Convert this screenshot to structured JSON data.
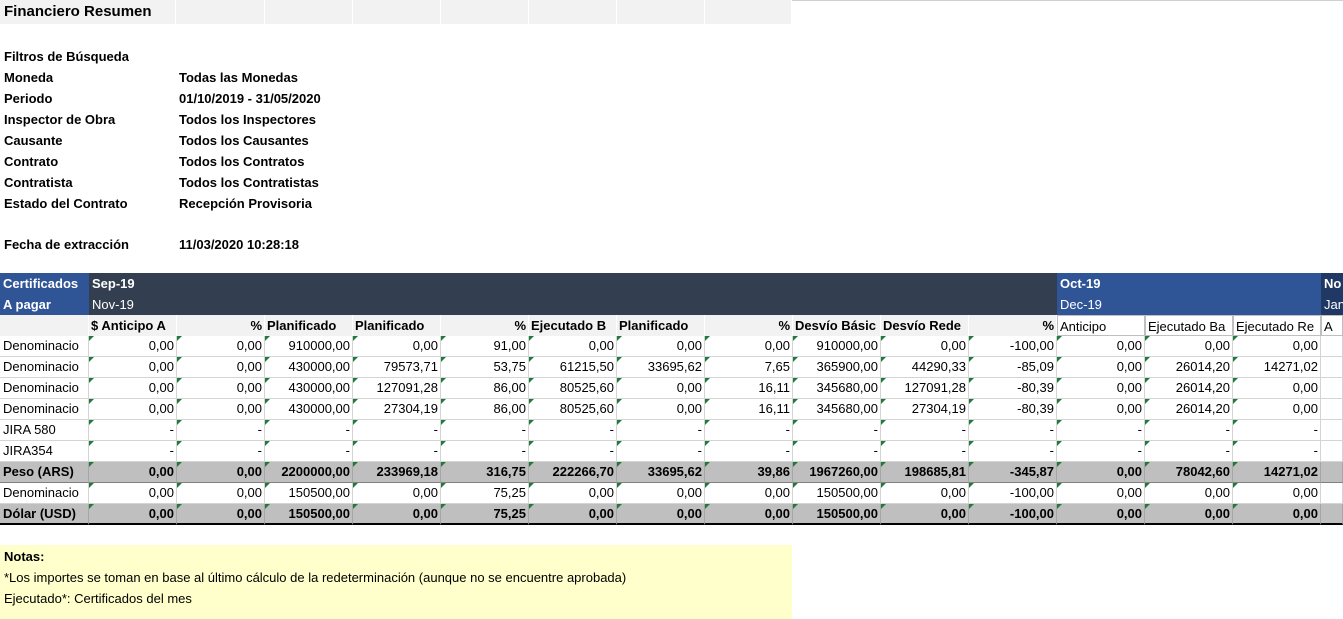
{
  "sheet": {
    "title": "Financiero Resumen"
  },
  "filters": {
    "section_label": "Filtros de Búsqueda",
    "items": [
      {
        "label": "Moneda",
        "value": "Todas las Monedas"
      },
      {
        "label": "Periodo",
        "value": "01/10/2019 - 31/05/2020"
      },
      {
        "label": "Inspector de Obra",
        "value": "Todos los Inspectores"
      },
      {
        "label": "Causante",
        "value": "Todos los Causantes"
      },
      {
        "label": "Contrato",
        "value": "Todos los Contratos"
      },
      {
        "label": "Contratista",
        "value": "Todos los Contratistas"
      },
      {
        "label": "Estado del Contrato",
        "value": "Recepción Provisoria"
      }
    ],
    "extraction_label": "Fecha de extracción",
    "extraction_value": "11/03/2020 10:28:18"
  },
  "table": {
    "header_row1": {
      "first": "Certificados",
      "period_a": "Sep-19",
      "period_b": "Oct-19",
      "period_c": "No"
    },
    "header_row2": {
      "first": "A pagar",
      "period_a": "Nov-19",
      "period_b": "Dec-19",
      "period_c": "Jan"
    },
    "column_headers": [
      "",
      "$ Anticipo  A",
      "%",
      "Planificado",
      "Planificado",
      "%",
      "Ejecutado  B",
      "Planificado",
      "%",
      "Desvío  Básic",
      "Desvío  Rede",
      "%",
      "Anticipo",
      "Ejecutado   Ba",
      "Ejecutado   Re",
      "A"
    ],
    "rows": [
      {
        "type": "data",
        "cells": [
          "Denominacio",
          "0,00",
          "0,00",
          "910000,00",
          "0,00",
          "91,00",
          "0,00",
          "0,00",
          "0,00",
          "910000,00",
          "0,00",
          "-100,00",
          "0,00",
          "0,00",
          "0,00",
          ""
        ]
      },
      {
        "type": "data",
        "cells": [
          "Denominacio",
          "0,00",
          "0,00",
          "430000,00",
          "79573,71",
          "53,75",
          "61215,50",
          "33695,62",
          "7,65",
          "365900,00",
          "44290,33",
          "-85,09",
          "0,00",
          "26014,20",
          "14271,02",
          ""
        ]
      },
      {
        "type": "data",
        "cells": [
          "Denominacio",
          "0,00",
          "0,00",
          "430000,00",
          "127091,28",
          "86,00",
          "80525,60",
          "0,00",
          "16,11",
          "345680,00",
          "127091,28",
          "-80,39",
          "0,00",
          "26014,20",
          "0,00",
          ""
        ]
      },
      {
        "type": "data",
        "cells": [
          "Denominacio",
          "0,00",
          "0,00",
          "430000,00",
          "27304,19",
          "86,00",
          "80525,60",
          "0,00",
          "16,11",
          "345680,00",
          "27304,19",
          "-80,39",
          "0,00",
          "26014,20",
          "0,00",
          ""
        ]
      },
      {
        "type": "data",
        "cells": [
          "JIRA 580",
          "-",
          "-",
          "-",
          "-",
          "-",
          "-",
          "-",
          "-",
          "-",
          "-",
          "-",
          "-",
          "-",
          "-",
          ""
        ]
      },
      {
        "type": "data",
        "cells": [
          "JIRA354",
          "-",
          "-",
          "-",
          "-",
          "-",
          "-",
          "-",
          "-",
          "-",
          "-",
          "-",
          "-",
          "-",
          "-",
          ""
        ]
      },
      {
        "type": "total",
        "cells": [
          "Peso (ARS)",
          "0,00",
          "0,00",
          "2200000,00",
          "233969,18",
          "316,75",
          "222266,70",
          "33695,62",
          "39,86",
          "1967260,00",
          "198685,81",
          "-345,87",
          "0,00",
          "78042,60",
          "14271,02",
          ""
        ]
      },
      {
        "type": "data",
        "cells": [
          "Denominacio",
          "0,00",
          "0,00",
          "150500,00",
          "0,00",
          "75,25",
          "0,00",
          "0,00",
          "0,00",
          "150500,00",
          "0,00",
          "-100,00",
          "0,00",
          "0,00",
          "0,00",
          ""
        ]
      },
      {
        "type": "total",
        "cells": [
          "Dólar (USD)",
          "0,00",
          "0,00",
          "150500,00",
          "0,00",
          "75,25",
          "0,00",
          "0,00",
          "0,00",
          "150500,00",
          "0,00",
          "-100,00",
          "0,00",
          "0,00",
          "0,00",
          ""
        ]
      }
    ]
  },
  "notes": {
    "title": "Notas:",
    "lines": [
      "*Los importes se toman en base al último cálculo de la redeterminación (aunque no se encuentre aprobada)",
      "Ejecutado*: Certificados del mes"
    ]
  },
  "colors": {
    "header_dark": "#333f50",
    "header_blue": "#2f5597",
    "total_row": "#bfbfbf",
    "notes_bg": "#ffffcc",
    "marker_green": "#1e7b3a"
  }
}
